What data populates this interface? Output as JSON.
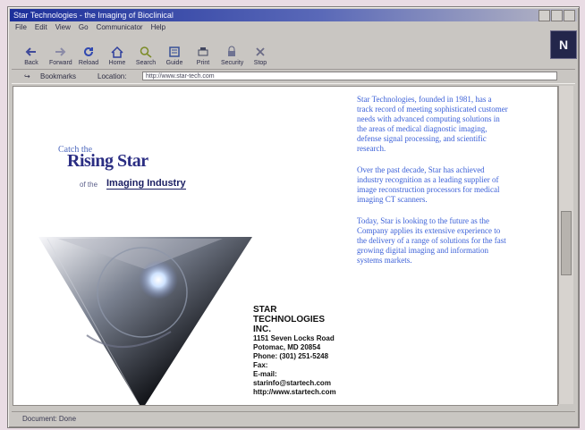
{
  "window": {
    "title": "Star Technologies - the Imaging of Bioclinical",
    "window_buttons": [
      "minimize-icon",
      "maximize-icon",
      "close-icon"
    ]
  },
  "menu": [
    "File",
    "Edit",
    "View",
    "Go",
    "Communicator",
    "Help"
  ],
  "toolbar": {
    "items": [
      {
        "label": "Back",
        "icon": "back-icon"
      },
      {
        "label": "Forward",
        "icon": "forward-icon"
      },
      {
        "label": "Reload",
        "icon": "reload-icon"
      },
      {
        "label": "Home",
        "icon": "home-icon"
      },
      {
        "label": "Search",
        "icon": "search-icon"
      },
      {
        "label": "Guide",
        "icon": "guide-icon"
      },
      {
        "label": "Print",
        "icon": "print-icon"
      },
      {
        "label": "Security",
        "icon": "security-icon"
      },
      {
        "label": "Stop",
        "icon": "stop-icon"
      }
    ]
  },
  "location": {
    "bookmarks": "Bookmarks",
    "label": "Location:",
    "url": "http://www.star-tech.com"
  },
  "brand_logo": "N",
  "page": {
    "catch": "Catch the",
    "rising": "Rising Star",
    "inthe": "of the",
    "imaging": "Imaging Industry",
    "company": {
      "name_line1": "STAR",
      "name_line2": "TECHNOLOGIES",
      "name_line3": "INC.",
      "address": "1151 Seven Locks Road",
      "city": "Potomac, MD 20854",
      "phone": "Phone: (301) 251-5248",
      "fax": "Fax:",
      "email_label": "E-mail:",
      "email": "starinfo@startech.com",
      "web": "http://www.startech.com"
    },
    "paragraphs": [
      "Star Technologies, founded in 1981, has a track record of meeting sophisticated customer needs with advanced computing solutions in the areas of medical diagnostic imaging, defense signal processing, and scientific research.",
      "Over the past decade, Star has achieved industry recognition as a leading supplier of image reconstruction processors for medical imaging CT scanners.",
      "Today, Star is looking to the future as the Company applies its extensive experience to the delivery of a range of solutions for the fast growing digital imaging and information systems markets."
    ]
  },
  "status": {
    "left": "Document: Done",
    "right": ""
  },
  "colors": {
    "title_bar": "#1c2f9a",
    "body_copy": "#3c61d8",
    "window_bg": "#c9c6c2"
  }
}
